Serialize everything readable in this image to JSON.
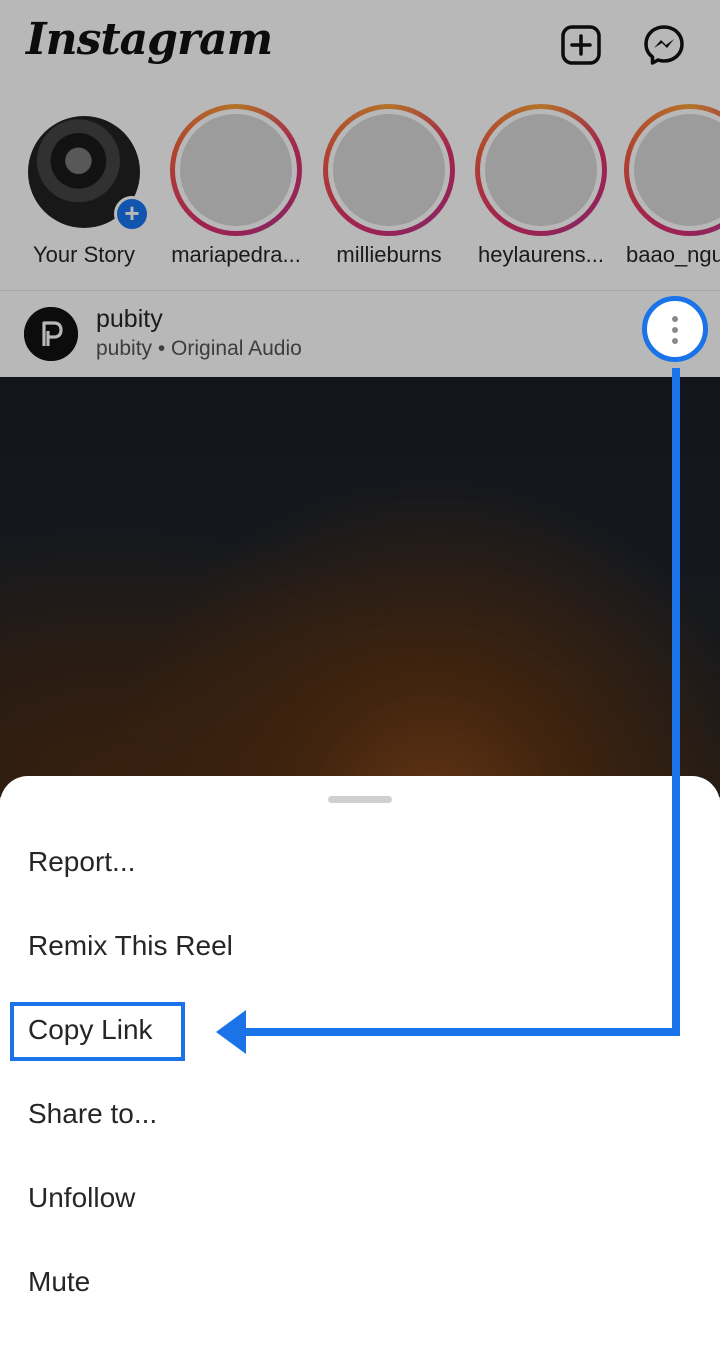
{
  "header": {
    "app_name": "Instagram",
    "new_post_icon": "plus-square-icon",
    "messenger_icon": "messenger-icon"
  },
  "stories": [
    {
      "name": "Your Story",
      "own": true
    },
    {
      "name": "mariapedra..."
    },
    {
      "name": "millieburns"
    },
    {
      "name": "heylaurens..."
    },
    {
      "name": "baao_ngu"
    }
  ],
  "post": {
    "username": "pubity",
    "subtitle": "pubity • Original Audio",
    "more_icon": "more-vertical-icon"
  },
  "sheet": {
    "items": [
      {
        "label": "Report..."
      },
      {
        "label": "Remix This Reel"
      },
      {
        "label": "Copy Link",
        "highlighted": true
      },
      {
        "label": "Share to..."
      },
      {
        "label": "Unfollow"
      },
      {
        "label": "Mute"
      }
    ]
  },
  "annotation": {
    "color": "#1a73e8"
  }
}
